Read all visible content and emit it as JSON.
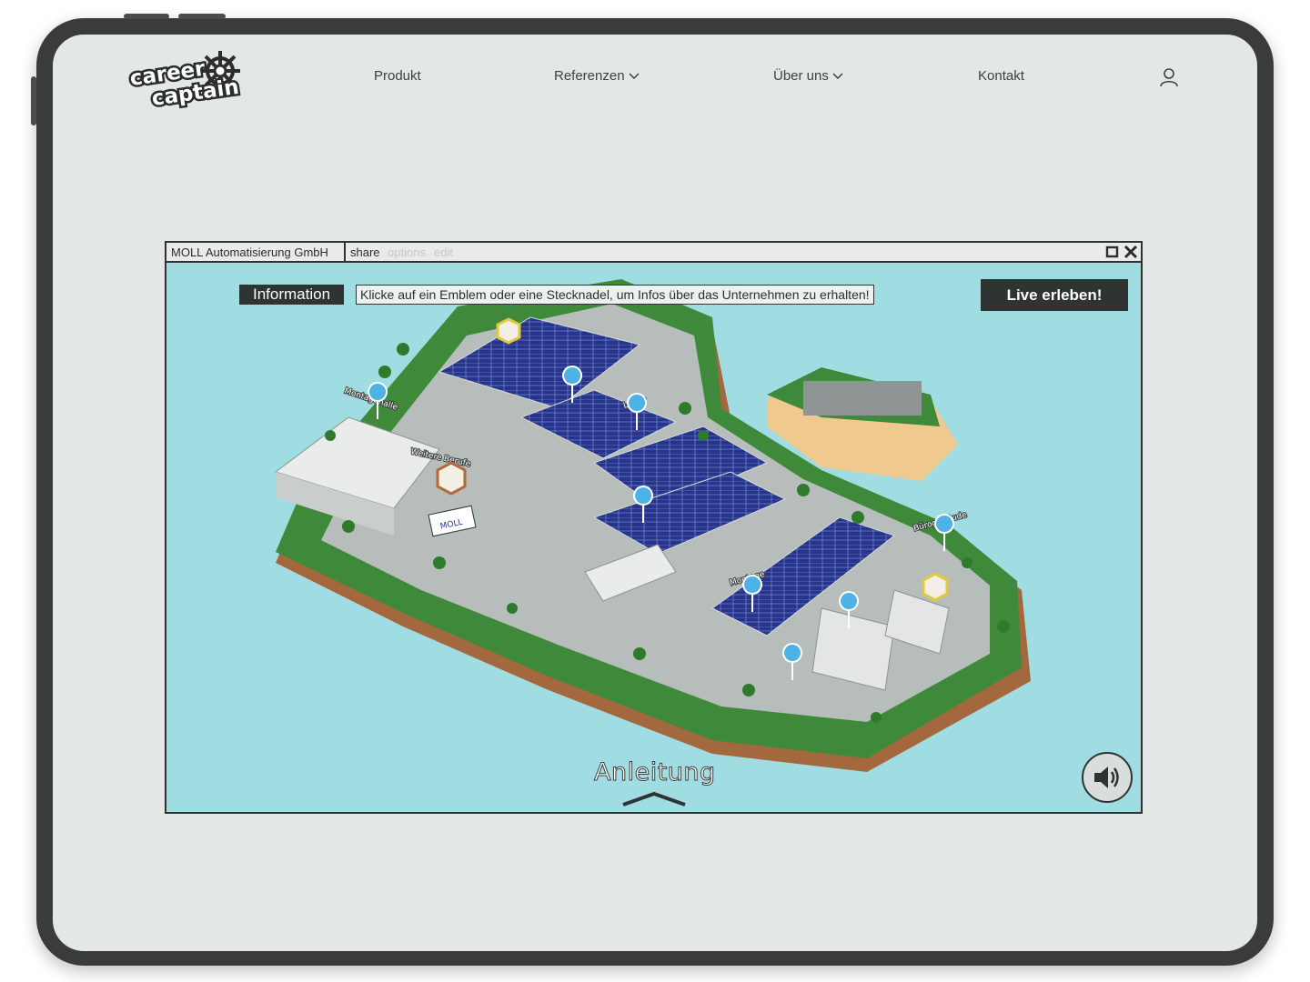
{
  "brand": {
    "logo_line1": "career",
    "logo_line2": "captain"
  },
  "nav": {
    "items": [
      {
        "label": "Produkt",
        "has_dropdown": false
      },
      {
        "label": "Referenzen",
        "has_dropdown": true
      },
      {
        "label": "Über uns",
        "has_dropdown": true
      },
      {
        "label": "Kontakt",
        "has_dropdown": false
      }
    ],
    "user_icon": "user-icon"
  },
  "window": {
    "title": "MOLL Automatisierung GmbH",
    "links": [
      "share",
      "options",
      "edit"
    ],
    "controls": [
      "maximize-icon",
      "close-icon"
    ]
  },
  "scene": {
    "info_label": "Information",
    "info_text": "Klicke auf ein Emblem oder eine Stecknadel, um Infos über das Unternehmen zu erhalten!",
    "live_button": "Live erleben!",
    "guide_label": "Anleitung",
    "sign_text": "MOLL",
    "building_labels": [
      "Montagehalle",
      "Weitere Berufe",
      "Lager",
      "Montage",
      "Bürogebäude"
    ],
    "colors": {
      "water": "#9fdde3",
      "grass": "#3f8a3a",
      "roof_solar": "#2a3a8c",
      "pin": "#4db3e6",
      "dark": "#2f3433"
    }
  }
}
